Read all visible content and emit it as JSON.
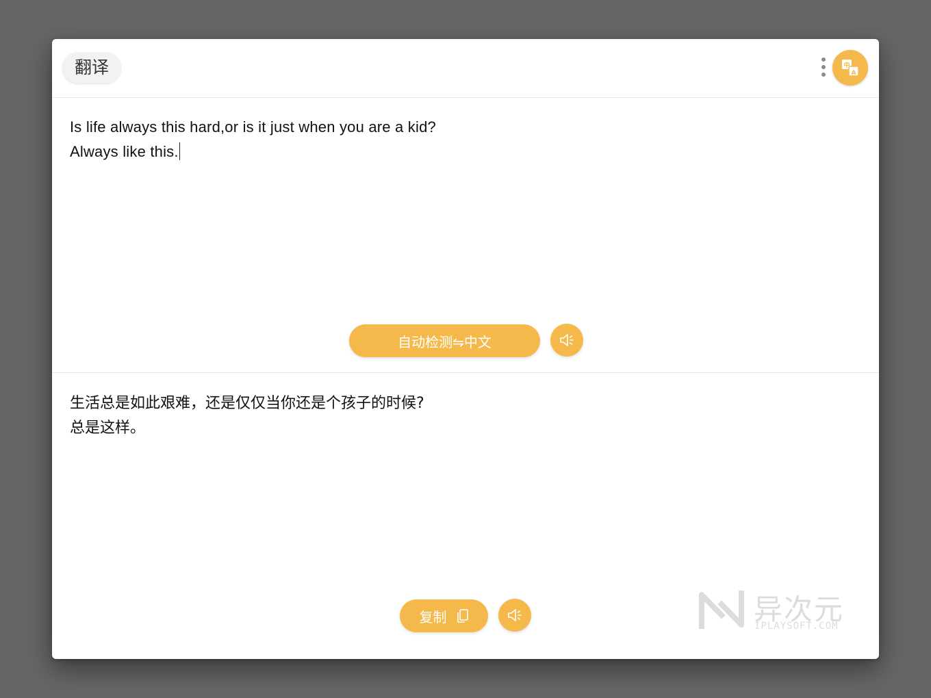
{
  "header": {
    "title": "翻译"
  },
  "source": {
    "line1": "Is life always this hard,or is it just when you are a kid?",
    "line2": "Always like this."
  },
  "language_button": {
    "label": "自动检测⇋中文"
  },
  "translation": {
    "line1": "生活总是如此艰难，还是仅仅当你还是个孩子的时候?",
    "line2": "总是这样。"
  },
  "copy_button": {
    "label": "复制"
  },
  "watermark": {
    "cn": "异次元",
    "en": "IPLAYSOFT.COM"
  },
  "colors": {
    "accent": "#f5b84b",
    "background": "#666666"
  },
  "icons": {
    "more": "more-vertical-icon",
    "logo": "translate-icon",
    "speaker": "speaker-icon",
    "copy": "copy-icon"
  }
}
